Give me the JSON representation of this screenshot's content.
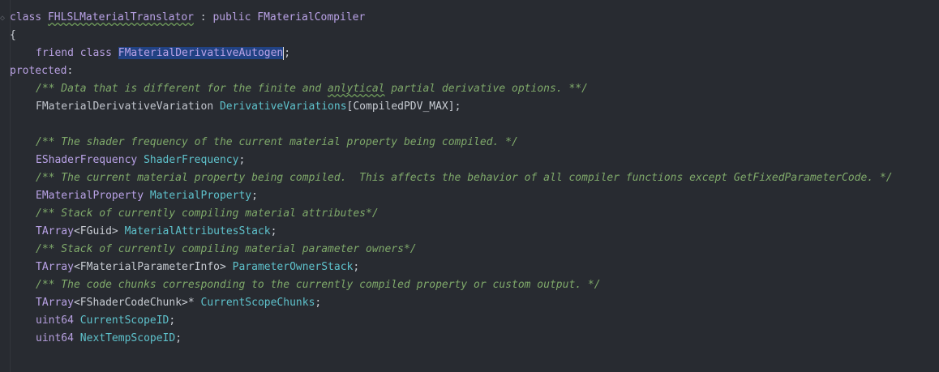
{
  "editor": {
    "lines": [
      {
        "id": "l1",
        "tokens": [
          {
            "t": "class ",
            "c": "kw"
          },
          {
            "t": "FHLSLMaterialTranslator",
            "c": "cls under"
          },
          {
            "t": " : ",
            "c": "sym"
          },
          {
            "t": "public ",
            "c": "kw"
          },
          {
            "t": "FMaterialCompiler",
            "c": "cls"
          }
        ]
      },
      {
        "id": "l2",
        "tokens": [
          {
            "t": "{",
            "c": "sym"
          }
        ]
      },
      {
        "id": "l3",
        "tokens": [
          {
            "t": "friend ",
            "c": "kw"
          },
          {
            "t": "class ",
            "c": "kw"
          },
          {
            "t": "FMaterialDerivativeAutogen",
            "c": "sel"
          },
          {
            "t": "",
            "c": "caret"
          },
          {
            "t": ";",
            "c": "sym"
          }
        ]
      },
      {
        "id": "l4",
        "tokens": [
          {
            "t": "protected",
            "c": "kw"
          },
          {
            "t": ":",
            "c": "sym"
          }
        ]
      },
      {
        "id": "l5",
        "tokens": [
          {
            "t": "/** Data that is different for the finite and ",
            "c": "cmt"
          },
          {
            "t": "anlytical",
            "c": "cmt under"
          },
          {
            "t": " partial derivative options. **/",
            "c": "cmt"
          }
        ]
      },
      {
        "id": "l6",
        "tokens": [
          {
            "t": "FMaterialDerivativeVariation ",
            "c": "type"
          },
          {
            "t": "DerivativeVariations",
            "c": "ident"
          },
          {
            "t": "[CompiledPDV_MAX];",
            "c": "sym"
          }
        ]
      },
      {
        "id": "l7",
        "tokens": []
      },
      {
        "id": "l8",
        "tokens": [
          {
            "t": "/** The shader frequency of the current material property being compiled. */",
            "c": "cmt"
          }
        ]
      },
      {
        "id": "l9",
        "tokens": [
          {
            "t": "EShaderFrequency ",
            "c": "cls"
          },
          {
            "t": "ShaderFrequency",
            "c": "ident"
          },
          {
            "t": ";",
            "c": "sym"
          }
        ]
      },
      {
        "id": "l10",
        "tokens": [
          {
            "t": "/** The current material property being compiled.  This affects the behavior of all compiler functions except GetFixedParameterCode. */",
            "c": "cmt"
          }
        ]
      },
      {
        "id": "l11",
        "tokens": [
          {
            "t": "EMaterialProperty ",
            "c": "cls"
          },
          {
            "t": "MaterialProperty",
            "c": "ident"
          },
          {
            "t": ";",
            "c": "sym"
          }
        ]
      },
      {
        "id": "l12",
        "tokens": [
          {
            "t": "/** Stack of currently compiling material attributes*/",
            "c": "cmt"
          }
        ]
      },
      {
        "id": "l13",
        "tokens": [
          {
            "t": "TArray",
            "c": "cls"
          },
          {
            "t": "<FGuid> ",
            "c": "sym"
          },
          {
            "t": "MaterialAttributesStack",
            "c": "ident"
          },
          {
            "t": ";",
            "c": "sym"
          }
        ]
      },
      {
        "id": "l14",
        "tokens": [
          {
            "t": "/** Stack of currently compiling material parameter owners*/",
            "c": "cmt"
          }
        ]
      },
      {
        "id": "l15",
        "tokens": [
          {
            "t": "TArray",
            "c": "cls"
          },
          {
            "t": "<FMaterialParameterInfo> ",
            "c": "sym"
          },
          {
            "t": "ParameterOwnerStack",
            "c": "ident"
          },
          {
            "t": ";",
            "c": "sym"
          }
        ]
      },
      {
        "id": "l16",
        "tokens": [
          {
            "t": "/** The code chunks corresponding to the currently compiled property or custom output. */",
            "c": "cmt"
          }
        ]
      },
      {
        "id": "l17",
        "tokens": [
          {
            "t": "TArray",
            "c": "cls"
          },
          {
            "t": "<FShaderCodeChunk>* ",
            "c": "sym"
          },
          {
            "t": "CurrentScopeChunks",
            "c": "ident"
          },
          {
            "t": ";",
            "c": "sym"
          }
        ]
      },
      {
        "id": "l18",
        "tokens": [
          {
            "t": "uint64 ",
            "c": "kw"
          },
          {
            "t": "CurrentScopeID",
            "c": "ident"
          },
          {
            "t": ";",
            "c": "sym"
          }
        ]
      },
      {
        "id": "l19",
        "tokens": [
          {
            "t": "uint64 ",
            "c": "kw"
          },
          {
            "t": "NextTempScopeID",
            "c": "ident"
          },
          {
            "t": ";",
            "c": "sym"
          }
        ]
      },
      {
        "id": "l20",
        "tokens": []
      }
    ]
  }
}
